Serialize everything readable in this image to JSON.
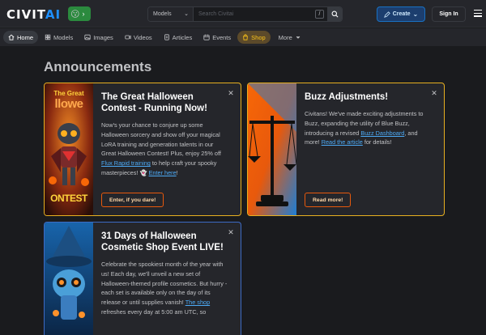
{
  "brand": {
    "logo_main": "CIVIT",
    "logo_accent": "AI",
    "badge_emoji": "😗"
  },
  "search": {
    "scope": "Models",
    "placeholder": "Search Civitai",
    "shortcut": "/"
  },
  "header": {
    "create_label": "Create",
    "signin_label": "Sign In"
  },
  "nav": {
    "items": [
      {
        "label": "Home",
        "icon": "home-icon"
      },
      {
        "label": "Models",
        "icon": "layers-icon"
      },
      {
        "label": "Images",
        "icon": "photo-icon"
      },
      {
        "label": "Videos",
        "icon": "video-icon"
      },
      {
        "label": "Articles",
        "icon": "file-icon"
      },
      {
        "label": "Events",
        "icon": "calendar-icon"
      },
      {
        "label": "Shop",
        "icon": "shopping-bag-icon"
      },
      {
        "label": "More",
        "icon": "chevron-down-icon"
      }
    ]
  },
  "page": {
    "title": "Announcements"
  },
  "announcements": [
    {
      "title": "The Great Halloween Contest - Running Now!",
      "text_1": "Now's your chance to conjure up some Halloween sorcery and show off your magical LoRA training and generation talents in our Great Halloween Contest! Plus, enjoy 25% off ",
      "link_1": "Flux Rapid training",
      "text_2": " to help craft your spooky masterpieces! 👻 ",
      "link_2": "Enter here",
      "text_3": "!",
      "cta": "Enter, if you dare!",
      "art_text_top": "The Great",
      "art_text_mid": "llowe",
      "art_text_bottom": "ONTEST"
    },
    {
      "title": "Buzz Adjustments!",
      "text_1": "Civitans! We've made exciting adjustments to Buzz, expanding the utility of Blue Buzz, introducing a revised ",
      "link_1": "Buzz Dashboard",
      "text_2": ", and more! ",
      "link_2": "Read the article",
      "text_3": " for details!",
      "cta": "Read more!"
    },
    {
      "title": "31 Days of Halloween Cosmetic Shop Event LIVE!",
      "text_1": "Celebrate the spookiest month of the year with us! Each day, we'll unveil a new set of Halloween-themed profile cosmetics. But hurry - each set is available only on the day of its release or until supplies vanish! ",
      "link_1": "The shop",
      "text_2": " refreshes every day at 5:00 am UTC, so"
    }
  ],
  "colors": {
    "accent_gold": "#e8b020",
    "accent_blue": "#3d6bc4",
    "link": "#4dabf7",
    "cta_border": "#e8590c"
  }
}
